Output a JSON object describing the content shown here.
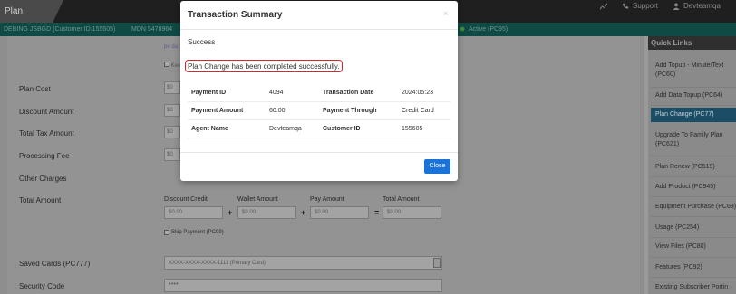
{
  "header": {
    "title": "Plan Change",
    "support": "Support",
    "user": "Devteamqa"
  },
  "infobar": {
    "customer": "DEBING JSBGD (Customer ID:155605)",
    "mdn": "MDN 5478964",
    "status": "Active (PC95)"
  },
  "form": {
    "rows": [
      {
        "label": "Plan Cost",
        "value": "$0"
      },
      {
        "label": "Discount Amount",
        "value": "$0"
      },
      {
        "label": "Total Tax Amount",
        "value": "$0"
      },
      {
        "label": "Processing Fee",
        "value": "$0"
      }
    ],
    "other_charges": "Other Charges",
    "total_amount": "Total Amount",
    "columns": [
      {
        "label": "Discount Credit",
        "value": "$0.00"
      },
      {
        "label": "Wallet Amount",
        "value": "$0.00"
      },
      {
        "label": "Pay Amount",
        "value": "$0.00"
      },
      {
        "label": "Total Amount",
        "value": "$0.00"
      }
    ],
    "ops": [
      "+",
      "+",
      "="
    ],
    "skip_payment": "Skip Payment (PC99)",
    "saved_cards_label": "Saved Cards (PC777)",
    "saved_card_value": "XXXX-XXXX-XXXX-1111 (Primary Card)",
    "security_code_label": "Security Code",
    "security_code_value": "****",
    "mini_link": "pe da",
    "mini_checkbox": "Kee"
  },
  "quick_links": {
    "title": "Quick Links",
    "items": [
      "Add Topup - Minute/Text (PC60)",
      "Add Data Topup (PC64)",
      "Plan Change (PC77)",
      "Upgrade To Family Plan (PC621)",
      "Plan Renew (PC519)",
      "Add Product (PC945)",
      "Equipment Purchase (PC69)",
      "Usage (PC254)",
      "View Files (PC80)",
      "Features (PC92)",
      "Existing Subscriber Portin"
    ],
    "active_index": 2
  },
  "modal": {
    "title": "Transaction Summary",
    "close_icon": "×",
    "status": "Success",
    "message": "Plan Change has been completed successfully.",
    "rows": [
      {
        "k1": "Payment ID",
        "v1": "4094",
        "k2": "Transaction Date",
        "v2": "2024:05:23"
      },
      {
        "k1": "Payment Amount",
        "v1": "60.00",
        "k2": "Payment Through",
        "v2": "Credit Card"
      },
      {
        "k1": "Agent Name",
        "v1": "Devteamqa",
        "k2": "Customer ID",
        "v2": "155605"
      }
    ],
    "close_button": "Close"
  },
  "colors": {
    "accent": "#1a73d9",
    "highlight_border": "#d9262c",
    "infobar": "#0f4a44",
    "active_link": "#1b4d66"
  }
}
